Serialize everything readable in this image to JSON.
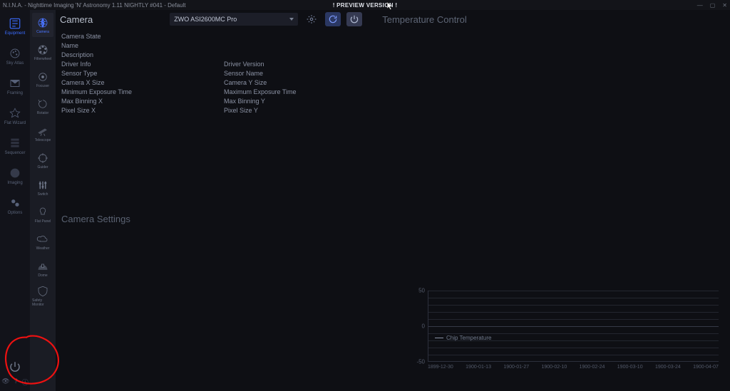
{
  "title": "N.I.N.A. - Nighttime Imaging 'N' Astronomy 1.11 NIGHTLY #041 - Default",
  "preview_banner": "! PREVIEW VERSION !",
  "main_tabs": [
    {
      "name": "equipment",
      "label": "Equipment"
    },
    {
      "name": "skyatlas",
      "label": "Sky Atlas"
    },
    {
      "name": "framing",
      "label": "Framing"
    },
    {
      "name": "flatwizard",
      "label": "Flat Wizard"
    },
    {
      "name": "sequencer",
      "label": "Sequencer"
    },
    {
      "name": "imaging",
      "label": "Imaging"
    },
    {
      "name": "options",
      "label": "Options"
    }
  ],
  "equip_tabs": [
    {
      "name": "camera",
      "label": "Camera"
    },
    {
      "name": "filterwheel",
      "label": "Filterwheel"
    },
    {
      "name": "focuser",
      "label": "Focuser"
    },
    {
      "name": "rotator",
      "label": "Rotator"
    },
    {
      "name": "telescope",
      "label": "Telescope"
    },
    {
      "name": "guider",
      "label": "Guider"
    },
    {
      "name": "switch",
      "label": "Switch"
    },
    {
      "name": "flatpanel",
      "label": "Flat Panel"
    },
    {
      "name": "weather",
      "label": "Weather"
    },
    {
      "name": "dome",
      "label": "Dome"
    },
    {
      "name": "safetymonitor",
      "label": "Safety Monitor"
    }
  ],
  "page_title": "Camera",
  "camera_selected": "ZWO ASI2600MC Pro",
  "temp_title": "Temperature Control",
  "kv_left": [
    "Camera State",
    "Name",
    "Description",
    "Driver Info",
    "Sensor Type",
    "Camera X Size",
    "Minimum Exposure Time",
    "Max Binning X",
    "Pixel Size X"
  ],
  "kv_right": [
    "Driver Version",
    "Sensor Name",
    "Camera Y Size",
    "Maximum Exposure Time",
    "Max Binning Y",
    "Pixel Size Y"
  ],
  "cam_settings_title": "Camera Settings",
  "chart_data": {
    "type": "line",
    "title": "",
    "series": [
      {
        "name": "Chip Temperature",
        "values": []
      }
    ],
    "ylim": [
      -50,
      50
    ],
    "yticks": [
      -50,
      0,
      50
    ],
    "xticks": [
      "1899-12-30",
      "1900-01-13",
      "1900-01-27",
      "1900-02-10",
      "1900-02-24",
      "1900-03-10",
      "1900-03-24",
      "1900-04-07"
    ],
    "legend": "Chip Temperature"
  }
}
